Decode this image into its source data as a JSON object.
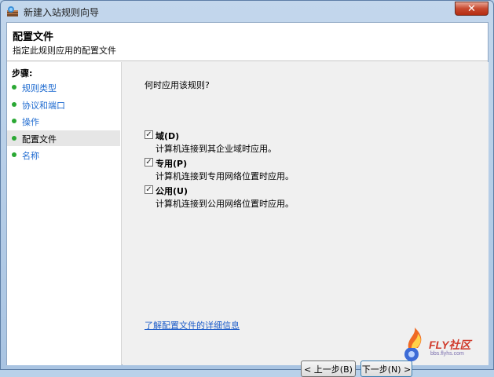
{
  "window": {
    "title": "新建入站规则向导",
    "close_glyph": "✕"
  },
  "header": {
    "title": "配置文件",
    "subtitle": "指定此规则应用的配置文件"
  },
  "steps": {
    "title": "步骤:",
    "items": [
      {
        "label": "规则类型",
        "active": false
      },
      {
        "label": "协议和端口",
        "active": false
      },
      {
        "label": "操作",
        "active": false
      },
      {
        "label": "配置文件",
        "active": true
      },
      {
        "label": "名称",
        "active": false
      }
    ]
  },
  "main": {
    "question": "何时应用该规则?",
    "options": [
      {
        "label": "域(D)",
        "description": "计算机连接到其企业域时应用。",
        "checked": true
      },
      {
        "label": "专用(P)",
        "description": "计算机连接到专用网络位置时应用。",
        "checked": true
      },
      {
        "label": "公用(U)",
        "description": "计算机连接到公用网络位置时应用。",
        "checked": true
      }
    ],
    "learn_more_link": "了解配置文件的详细信息",
    "check_glyph": "✓"
  },
  "buttons": {
    "back": "< 上一步(B)",
    "next": "下一步(N) >"
  },
  "watermark": {
    "text": "FLY社区",
    "sub": "bbs.flyhs.com"
  },
  "colors": {
    "step_link": "#1f6bd0",
    "bullet": "#2aa834",
    "link": "#1f5ec9",
    "close_button": "#c7492f"
  }
}
